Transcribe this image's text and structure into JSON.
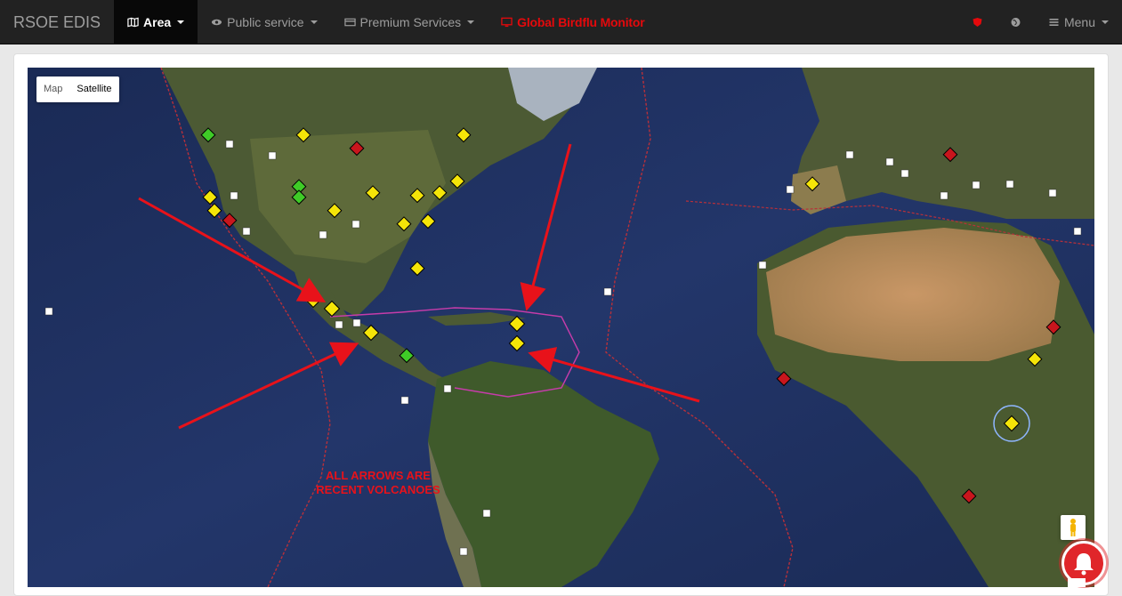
{
  "navbar": {
    "brand": "RSOE EDIS",
    "items": [
      {
        "label": "Area",
        "icon": "map-icon",
        "active": true
      },
      {
        "label": "Public service",
        "icon": "eye-icon"
      },
      {
        "label": "Premium Services",
        "icon": "card-icon"
      },
      {
        "label": "Global Birdflu Monitor",
        "icon": "monitor-icon"
      }
    ],
    "right": {
      "menu_label": "Menu",
      "icons": [
        "shield-icon",
        "globe-icon",
        "bars-icon"
      ]
    }
  },
  "map": {
    "type_buttons": [
      "Map",
      "Satellite"
    ],
    "selected_type": "Satellite",
    "annotation_line1": "ALL ARROWS ARE",
    "annotation_line2": "RECENT VOLCANOES"
  },
  "colors": {
    "navbar_bg": "#222222",
    "alert_red": "#e4090c",
    "ocean": "#1d2e5b",
    "land": "#3e4a2c",
    "desert": "#b88a5a",
    "arrow": "#e8121a",
    "warning_yellow": "#f5e508",
    "danger_red": "#c8161d",
    "ok_green": "#3fcb27"
  }
}
